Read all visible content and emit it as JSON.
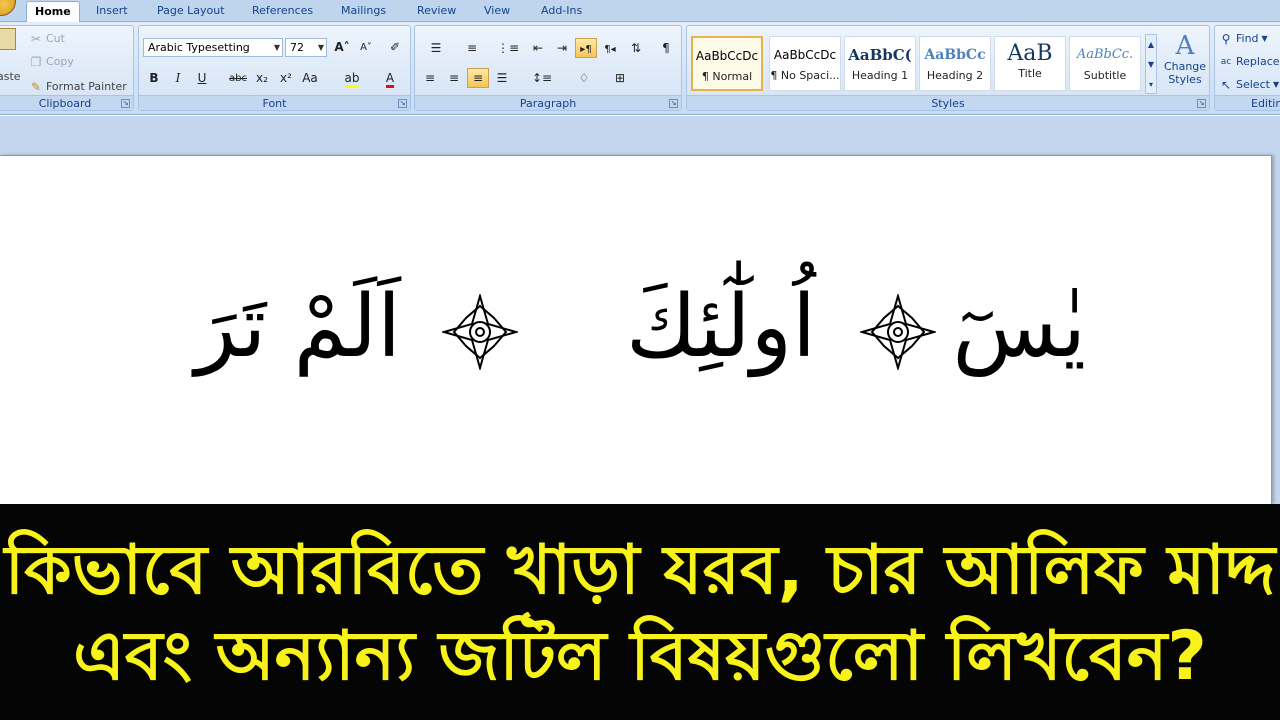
{
  "tabs": [
    "Home",
    "Insert",
    "Page Layout",
    "References",
    "Mailings",
    "Review",
    "View",
    "Add-Ins"
  ],
  "clipboard": {
    "paste_label": "aste",
    "cut_label": "Cut",
    "copy_label": "Copy",
    "format_painter_label": "Format Painter",
    "group_label": "Clipboard"
  },
  "font": {
    "family": "Arabic Typesetting",
    "size": "72",
    "bold": "B",
    "italic": "I",
    "underline": "U",
    "strike": "abc",
    "subscript": "x₂",
    "superscript": "x²",
    "change_case": "Aa",
    "font_color_glyph": "A",
    "grow_glyph": "A",
    "shrink_glyph": "A",
    "group_label": "Font"
  },
  "paragraph": {
    "group_label": "Paragraph",
    "pilcrow": "¶"
  },
  "styles": {
    "group_label": "Styles",
    "items": [
      {
        "sample": "AaBbCcDc",
        "name": "¶ Normal"
      },
      {
        "sample": "AaBbCcDc",
        "name": "¶ No Spaci..."
      },
      {
        "sample": "AaBbC(",
        "name": "Heading 1"
      },
      {
        "sample": "AaBbCc",
        "name": "Heading 2"
      },
      {
        "sample": "AaB",
        "name": "Title"
      },
      {
        "sample": "AaBbCc.",
        "name": "Subtitle"
      }
    ],
    "change_styles_line1": "Change",
    "change_styles_line2": "Styles"
  },
  "editing": {
    "group_label": "Editing",
    "find_label": "Find",
    "replace_label": "Replace",
    "select_label": "Select"
  },
  "document": {
    "words": [
      "يٰسٓ",
      "اُولٰٓئِكَ",
      "اَلَمْ تَرَ"
    ]
  },
  "caption": {
    "line1": "কিভাবে আরবিতে খাড়া যরব, চার আলিফ মাদ্দ",
    "line2": "এবং অন্যান্য জটিল বিষয়গুলো লিখবেন?"
  },
  "colors": {
    "caption_text": "#f7f31a",
    "caption_bg": "#050505",
    "ribbon_label": "#15428b",
    "selected_style_border": "#e7b24e"
  }
}
